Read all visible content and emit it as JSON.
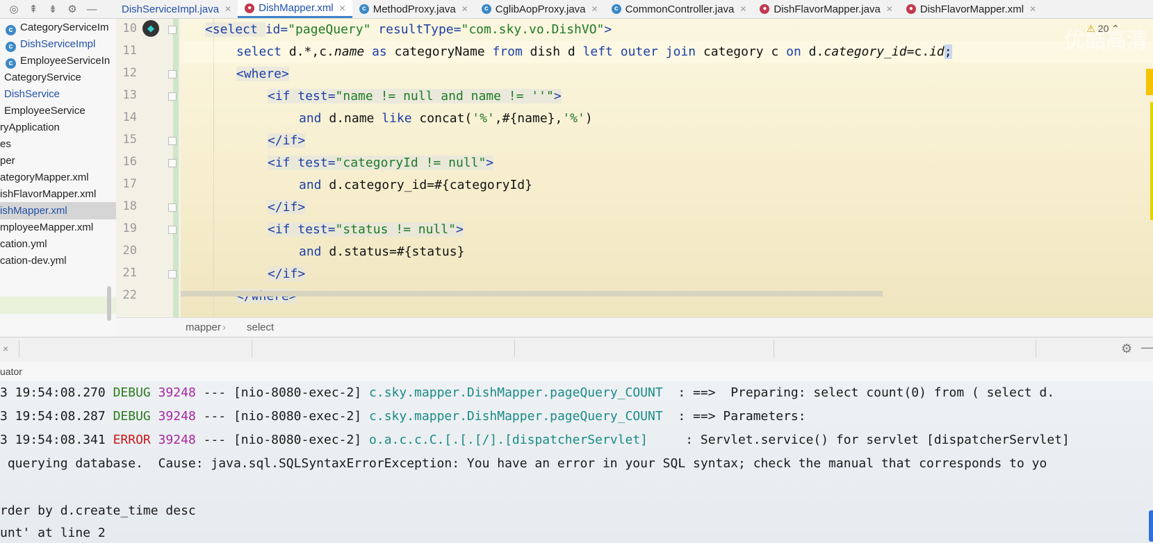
{
  "toolbar_icons": [
    "target-icon",
    "collapse-all-icon",
    "expand-all-icon",
    "gear-icon",
    "minimize-icon"
  ],
  "tabs": [
    {
      "label": "DishServiceImpl.java",
      "icon": "java-class-icon",
      "active": false,
      "blue": true
    },
    {
      "label": "DishMapper.xml",
      "icon": "mybatis-icon",
      "active": true,
      "blue": true
    },
    {
      "label": "MethodProxy.java",
      "icon": "java-class-icon",
      "active": false,
      "blue": false
    },
    {
      "label": "CglibAopProxy.java",
      "icon": "java-class-icon",
      "active": false,
      "blue": false
    },
    {
      "label": "CommonController.java",
      "icon": "java-class-icon",
      "active": false,
      "blue": false
    },
    {
      "label": "DishFlavorMapper.java",
      "icon": "mybatis-icon",
      "active": false,
      "blue": false
    },
    {
      "label": "DishFlavorMapper.xml",
      "icon": "mybatis-icon",
      "active": false,
      "blue": false
    }
  ],
  "project_tree": [
    {
      "label": "CategoryServiceIm",
      "class_icon": true
    },
    {
      "label": "DishServiceImpl",
      "class_icon": true,
      "blue": true
    },
    {
      "label": "EmployeeServiceIn",
      "class_icon": true
    },
    {
      "label": "CategoryService"
    },
    {
      "label": "DishService",
      "blue": true
    },
    {
      "label": "EmployeeService"
    },
    {
      "label": "ryApplication"
    },
    {
      "label": "es"
    },
    {
      "label": "per"
    },
    {
      "label": "ategoryMapper.xml"
    },
    {
      "label": "ishFlavorMapper.xml"
    },
    {
      "label": "ishMapper.xml",
      "selected": true,
      "blue": true
    },
    {
      "label": "mployeeMapper.xml"
    },
    {
      "label": "cation.yml"
    },
    {
      "label": "cation-dev.yml"
    }
  ],
  "editor": {
    "line_numbers": [
      "10",
      "11",
      "12",
      "13",
      "14",
      "15",
      "16",
      "17",
      "18",
      "19",
      "20",
      "21",
      "22"
    ],
    "inspection_badge": "20",
    "watermark": "优酷高清",
    "lines": {
      "l10_tag": "<select ",
      "l10_attr1": "id=",
      "l10_val1": "\"pageQuery\"",
      "l10_attr2": " resultType=",
      "l10_val2": "\"com.sky.vo.DishVO\"",
      "l10_close": ">",
      "l11_kw1": "select",
      "l11_t1": " d.*,c.",
      "l11_name": "name",
      "l11_kw2": " as",
      "l11_t2": " categoryName ",
      "l11_kw3": "from",
      "l11_t3": " dish d ",
      "l11_kw4": "left outer join",
      "l11_t4": " category c ",
      "l11_kw5": "on",
      "l11_t5": " d.",
      "l11_cid": "category_id",
      "l11_t6": "=c.",
      "l11_id": "id",
      "l11_semi": ";",
      "l12": "<where>",
      "l13_open": "<if ",
      "l13_attr": "test=",
      "l13_val": "\"name != null and name != ''\"",
      "l13_close": ">",
      "l14_kw": "and",
      "l14_t1": " d.name ",
      "l14_kw2": "like",
      "l14_t2": " concat(",
      "l14_s1": "'%'",
      "l14_t3": ",#{name},",
      "l14_s2": "'%'",
      "l14_t4": ")",
      "l15": "</if>",
      "l16_open": "<if ",
      "l16_attr": "test=",
      "l16_val": "\"categoryId != null\"",
      "l16_close": ">",
      "l17_kw": "and",
      "l17_t": " d.category_id=#{categoryId}",
      "l18": "</if>",
      "l19_open": "<if ",
      "l19_attr": "test=",
      "l19_val": "\"status != null\"",
      "l19_close": ">",
      "l20_kw": "and",
      "l20_t": " d.status=#{status}",
      "l21": "</if>",
      "l22": "</where>"
    }
  },
  "breadcrumb": [
    "mapper",
    "select"
  ],
  "console": {
    "close": "×",
    "subtitle": "uator",
    "logs": [
      {
        "time": "3 19:54:08.270 ",
        "level": "DEBUG",
        "pid": "39248",
        "thread": " --- [nio-8080-exec-2] ",
        "logger": "c.sky.mapper.DishMapper.pageQuery_COUNT ",
        "message": " : ==>  Preparing: select count(0) from ( select d."
      },
      {
        "time": "3 19:54:08.287 ",
        "level": "DEBUG",
        "pid": "39248",
        "thread": " --- [nio-8080-exec-2] ",
        "logger": "c.sky.mapper.DishMapper.pageQuery_COUNT ",
        "message": " : ==> Parameters: "
      },
      {
        "time": "3 19:54:08.341 ",
        "level": "ERROR",
        "pid": "39248",
        "thread": " --- [nio-8080-exec-2] ",
        "logger": "o.a.c.c.C.[.[.[/].[dispatcherServlet]    ",
        "message": " : Servlet.service() for servlet [dispatcherServlet]"
      }
    ],
    "plain_lines": [
      " querying database.  Cause: java.sql.SQLSyntaxErrorException: You have an error in your SQL syntax; check the manual that corresponds to yo",
      "",
      "rder by d.create_time desc",
      "unt' at line 2"
    ]
  }
}
